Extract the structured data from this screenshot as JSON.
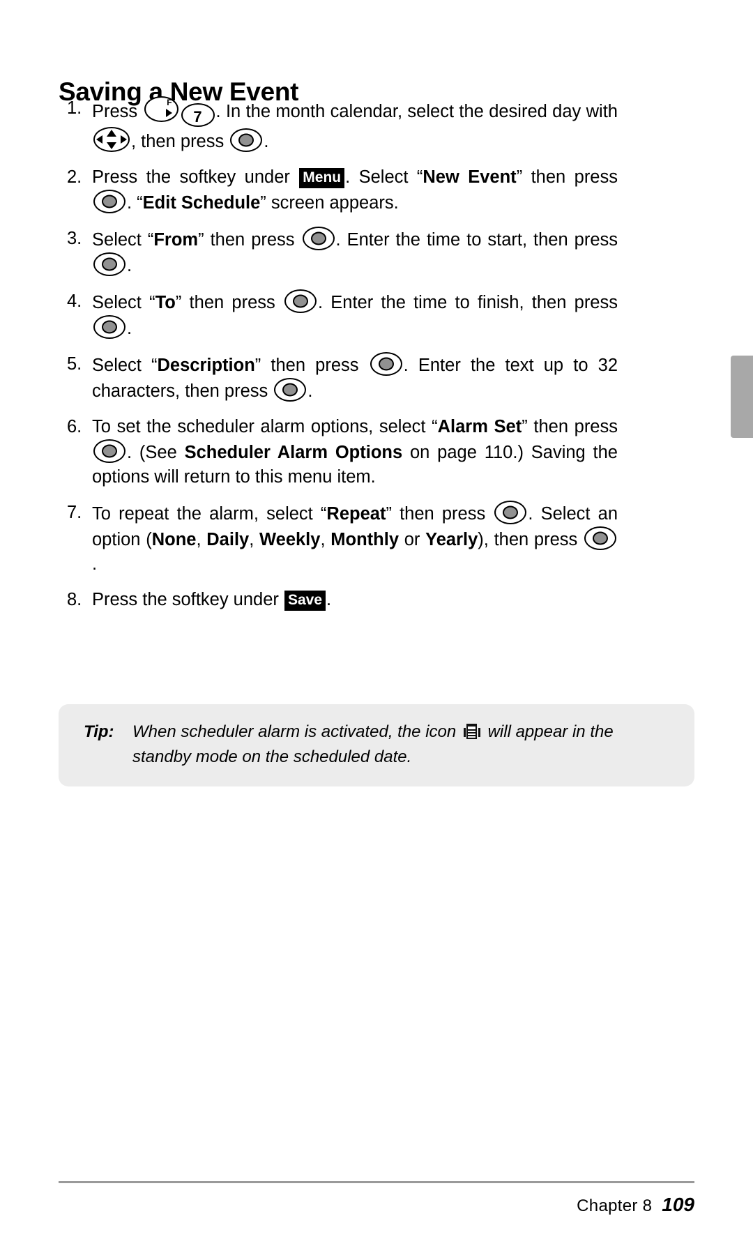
{
  "document": {
    "title": "Saving a New Event"
  },
  "keys": {
    "function_letter": "F",
    "number_7": "7",
    "menu_softkey": "Menu",
    "save_softkey": "Save"
  },
  "steps": [
    {
      "number": "1.",
      "segments": [
        {
          "type": "text",
          "text": "Press "
        },
        {
          "type": "key",
          "key": "function"
        },
        {
          "type": "key",
          "key": "seven"
        },
        {
          "type": "text",
          "text": ". In the month calendar, select the desired day with "
        },
        {
          "type": "key",
          "key": "navigation"
        },
        {
          "type": "text",
          "text": ", then press "
        },
        {
          "type": "key",
          "key": "ok"
        },
        {
          "type": "text",
          "text": "."
        }
      ],
      "plain": "Press [F] [7]. In the month calendar, select the desired day with [nav], then press [OK]."
    },
    {
      "number": "2.",
      "plain": "Press the softkey under [Menu]. Select “New Event” then press [OK]. “Edit Schedule” screen appears."
    },
    {
      "number": "3.",
      "plain": "Select “From” then press [OK]. Enter the time to start, then press [OK]."
    },
    {
      "number": "4.",
      "plain": "Select “To” then press [OK]. Enter the time to finish, then press [OK]."
    },
    {
      "number": "5.",
      "plain": "Select “Description” then press [OK]. Enter the text up to 32 characters, then press [OK]."
    },
    {
      "number": "6.",
      "plain": "To set the scheduler alarm options, select “Alarm Set” then press [OK]. (See Scheduler Alarm Options on page 110.) Saving the options will return to this menu item."
    },
    {
      "number": "7.",
      "plain": "To repeat the alarm, select “Repeat” then press [OK]. Select an option (None, Daily, Weekly, Monthly or Yearly), then press [OK]."
    },
    {
      "number": "8.",
      "plain": "Press the softkey under [Save]."
    }
  ],
  "step_text": {
    "s1_a": "Press ",
    "s1_b": ". In the month calendar, select the desired day with ",
    "s1_c": ", then press ",
    "s1_d": ".",
    "s2_a": "Press the softkey under ",
    "s2_b": ". Select “",
    "s2_bold1": "New Event",
    "s2_c": "” then press ",
    "s2_d": ". “",
    "s2_bold2": "Edit Schedule",
    "s2_e": "” screen appears.",
    "s3_a": "Select “",
    "s3_bold": "From",
    "s3_b": "” then press ",
    "s3_c": ". Enter the time to start, then press ",
    "s3_d": ".",
    "s4_a": "Select “",
    "s4_bold": "To",
    "s4_b": "” then press ",
    "s4_c": ". Enter the time to finish, then press ",
    "s4_d": ".",
    "s5_a": "Select “",
    "s5_bold": "Description",
    "s5_b": "” then press ",
    "s5_c": ". Enter the text up to 32 characters, then press ",
    "s5_d": ".",
    "s6_a": "To set the scheduler alarm options, select “",
    "s6_bold1": "Alarm Set",
    "s6_b": "” then press ",
    "s6_c": ". (See ",
    "s6_bold2": "Scheduler Alarm Options",
    "s6_d": " on page 110.) Saving the options will return to this menu item.",
    "s7_a": "To repeat the alarm, select “",
    "s7_bold1": "Repeat",
    "s7_b": "” then press ",
    "s7_c": ". Select an option (",
    "s7_opt1": "None",
    "s7_sep1": ", ",
    "s7_opt2": "Daily",
    "s7_sep2": ", ",
    "s7_opt3": "Weekly",
    "s7_sep3": ", ",
    "s7_opt4": "Monthly",
    "s7_sep4": " or ",
    "s7_opt5": "Yearly",
    "s7_d": "), then press ",
    "s7_e": ".",
    "s8_a": "Press the softkey under ",
    "s8_b": "."
  },
  "tip": {
    "label": "Tip:",
    "text_before": "When scheduler alarm is activated, the icon ",
    "text_after": " will appear in the standby mode on the scheduled date."
  },
  "footer": {
    "chapter": "Chapter 8",
    "page_number": "109"
  },
  "colors": {
    "tip_background": "#ececec",
    "edge_tab": "#a8a8a8",
    "key_center": "#919191",
    "softkey_background": "#000000",
    "footer_rule": "#9a9a9a"
  }
}
